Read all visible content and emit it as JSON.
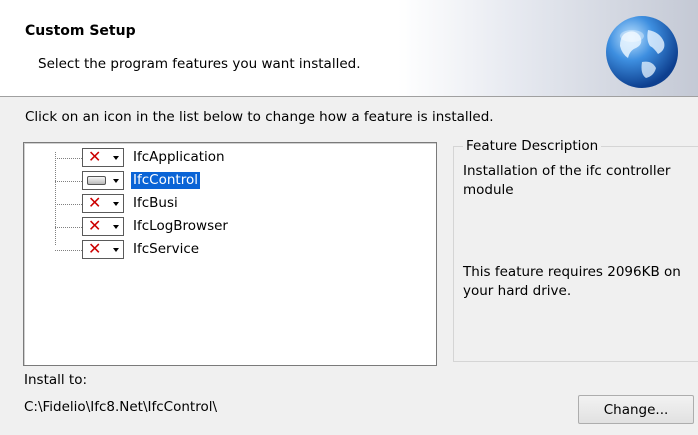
{
  "banner": {
    "title": "Custom Setup",
    "subtitle": "Select the program features you want installed.",
    "logo_icon": "globe-icon"
  },
  "instruction": "Click on an icon in the list below to change how a feature is installed.",
  "features": [
    {
      "label": "IfcApplication",
      "state": "not-installed",
      "icon": "red-x-icon",
      "selected": false
    },
    {
      "label": "IfcControl",
      "state": "install-local",
      "icon": "hard-drive-icon",
      "selected": true
    },
    {
      "label": "IfcBusi",
      "state": "not-installed",
      "icon": "red-x-icon",
      "selected": false
    },
    {
      "label": "IfcLogBrowser",
      "state": "not-installed",
      "icon": "red-x-icon",
      "selected": false
    },
    {
      "label": "IfcService",
      "state": "not-installed",
      "icon": "red-x-icon",
      "selected": false
    }
  ],
  "description": {
    "legend": "Feature Description",
    "text": "Installation of the ifc controller module",
    "size_text": "This feature requires 2096KB on your hard drive."
  },
  "install": {
    "label": "Install to:",
    "path": "C:\\Fidelio\\Ifc8.Net\\IfcControl\\"
  },
  "buttons": {
    "change_label": "Change..."
  },
  "colors": {
    "selection": "#0a64d6",
    "x_mark": "#cc0000"
  }
}
